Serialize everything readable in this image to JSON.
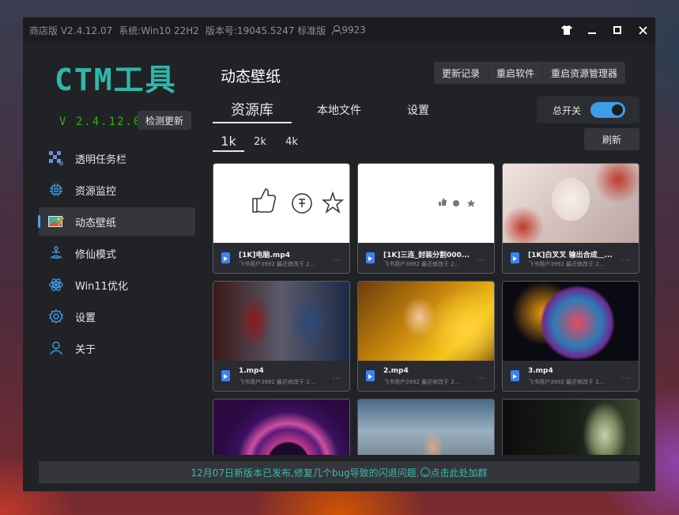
{
  "titlebar": {
    "edition": "商店版 V2.4.12.07",
    "system": "系统:Win10 22H2",
    "build": "版本号:19045.5247 标准版",
    "user_count": "9923"
  },
  "window_controls": [
    "shirt-icon",
    "minimize-icon",
    "maximize-icon",
    "close-icon"
  ],
  "sidebar": {
    "logo": "CTM工具",
    "version": "V 2.4.12.07",
    "check_update": "检测更新",
    "items": [
      {
        "label": "透明任务栏",
        "icon": "taskbar-icon",
        "active": false
      },
      {
        "label": "资源监控",
        "icon": "chip-icon",
        "active": false
      },
      {
        "label": "动态壁纸",
        "icon": "wallpaper-icon",
        "active": true
      },
      {
        "label": "修仙模式",
        "icon": "meditation-icon",
        "active": false
      },
      {
        "label": "Win11优化",
        "icon": "atom-icon",
        "active": false
      },
      {
        "label": "设置",
        "icon": "gear-icon",
        "active": false
      },
      {
        "label": "关于",
        "icon": "user-icon",
        "active": false
      }
    ]
  },
  "main": {
    "title": "动态壁纸",
    "buttons": {
      "changelog": "更新记录",
      "restart_app": "重启软件",
      "restart_explorer": "重启资源管理器"
    },
    "tabs": [
      {
        "label": "资源库",
        "active": true
      },
      {
        "label": "本地文件",
        "active": false
      },
      {
        "label": "设置",
        "active": false
      }
    ],
    "master_switch": {
      "label": "总开关",
      "on": true
    },
    "resolutions": [
      {
        "label": "1k",
        "active": true
      },
      {
        "label": "2k",
        "active": false
      },
      {
        "label": "4k",
        "active": false
      }
    ],
    "refresh": "刷新",
    "items": [
      {
        "name": "[1K]电脑.mp4",
        "meta": "飞书用户3992 最近修改于 2..."
      },
      {
        "name": "[1K]三连_封装分割000...",
        "meta": "飞书用户3992 最近修改于 2..."
      },
      {
        "name": "[1K]白叉叉 输出合成＿...",
        "meta": "飞书用户3992 最近修改于 2..."
      },
      {
        "name": "1.mp4",
        "meta": "飞书用户3992 最近修改于 2..."
      },
      {
        "name": "2.mp4",
        "meta": "飞书用户3992 最近修改于 2..."
      },
      {
        "name": "3.mp4",
        "meta": "飞书用户3992 最近修改于 2..."
      },
      {
        "name": "",
        "meta": ""
      },
      {
        "name": "",
        "meta": ""
      },
      {
        "name": "",
        "meta": ""
      }
    ]
  },
  "announcement": {
    "text_before": "12月07日新版本已发布,修复几个bug导致的闪退问题.",
    "text_after": "点击此处加群"
  },
  "colors": {
    "accent": "#3d9de8",
    "logo": "#2fb7a8",
    "version": "#2fb400",
    "announce": "#3db8b0"
  }
}
